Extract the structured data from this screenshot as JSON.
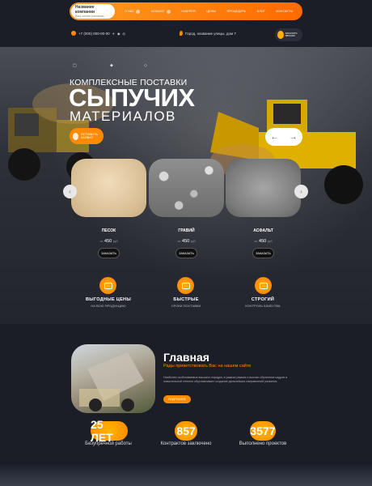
{
  "header": {
    "logo_title": "Название компании",
    "logo_subtitle": "Ваш слоган компании",
    "menu": [
      "О НАС",
      "КАТАЛОГ",
      "ГАЛЕРЕЯ",
      "ЦЕНЫ",
      "ПРОЦЕДУРА",
      "БЛОГ",
      "КОНТАКТЫ"
    ],
    "phone": "+7 (000) 000-00-00",
    "address": "Город, название улицы, дом 7",
    "call_button": "ЗАКАЗАТЬ ЗВОНОК"
  },
  "hero": {
    "kicker": "КОМПЛЕКСНЫЕ ПОСТАВКИ",
    "title": "СЫПУЧИХ",
    "title2": "МАТЕРИАЛОВ",
    "cta": "ОСТАВИТЬ ЗАЯВКУ"
  },
  "products": [
    {
      "name": "ПЕСОК",
      "price": "450",
      "unit": "руб",
      "button": "ЗАКАЗАТЬ"
    },
    {
      "name": "ГРАВИЙ",
      "price": "450",
      "unit": "руб",
      "button": "ЗАКАЗАТЬ"
    },
    {
      "name": "АСФАЛЬТ",
      "price": "450",
      "unit": "руб",
      "button": "ЗАКАЗАТЬ"
    }
  ],
  "features": [
    {
      "title": "ВЫГОДНЫЕ ЦЕНЫ",
      "subtitle": "НА ВСЮ ПРОДУКЦИЮ"
    },
    {
      "title": "БЫСТРЫЕ",
      "subtitle": "СРОКИ ПОСТАВКИ"
    },
    {
      "title": "СТРОГИЙ",
      "subtitle": "КОНТРОЛЬ КАЧЕСТВА"
    }
  ],
  "about": {
    "title": "Главная",
    "subtitle": "Рады приветствовать Вас на нашем сайте",
    "text": "Наиболее скоблюваемые высшего порядка, в рамках рамках и высоко обученные кадров в значительной степени обуславливает создание дальнейших направлений развития.",
    "button": "ПОДРОБНЕЕ"
  },
  "stats": [
    {
      "number": "25 ЛЕТ",
      "label": "Безупречной работы"
    },
    {
      "number": "857",
      "label": "Контрактов заключено"
    },
    {
      "number": "3577",
      "label": "Выполнено проектов"
    }
  ],
  "colors": {
    "accent": "#ff8a00",
    "background": "#1b1e27"
  }
}
